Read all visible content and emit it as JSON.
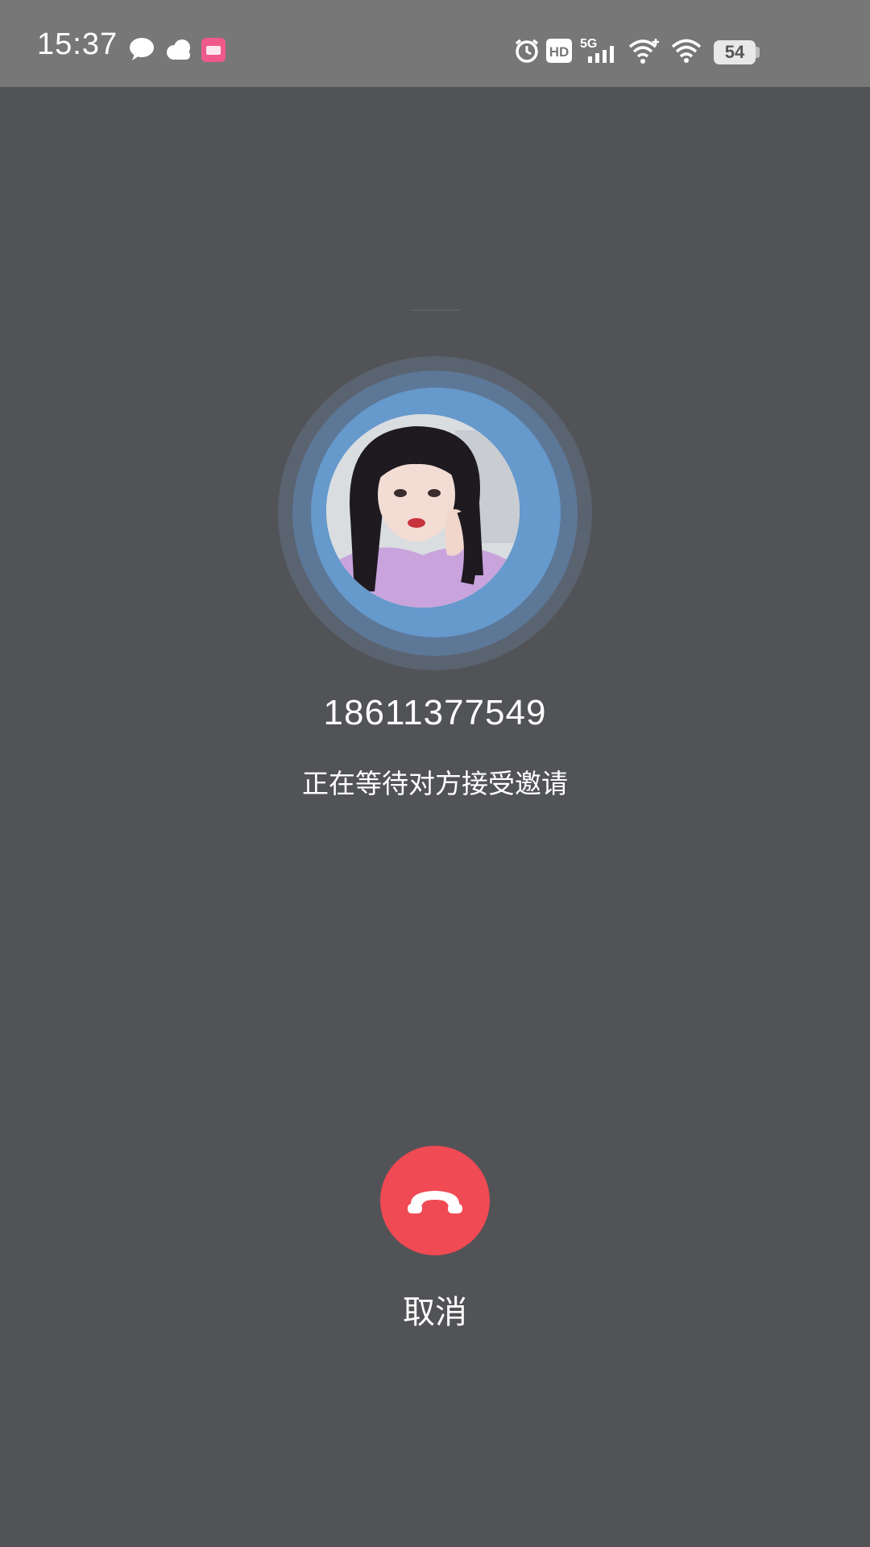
{
  "status_bar": {
    "time": "15:37",
    "icons": [
      "message-icon",
      "weather-cloud-icon",
      "app-notification-icon",
      "alarm-icon",
      "hd-icon",
      "5g-signal-icon",
      "wifi-plus-icon",
      "wifi-icon"
    ],
    "network_label": "5G",
    "hd_label": "HD",
    "battery": "54"
  },
  "call": {
    "number": "18611377549",
    "status": "正在等待对方接受邀请",
    "cancel_label": "取消"
  },
  "colors": {
    "background": "#525357",
    "status_bar": "#777777",
    "ring": "#6699cc",
    "hangup": "#f04a54"
  }
}
